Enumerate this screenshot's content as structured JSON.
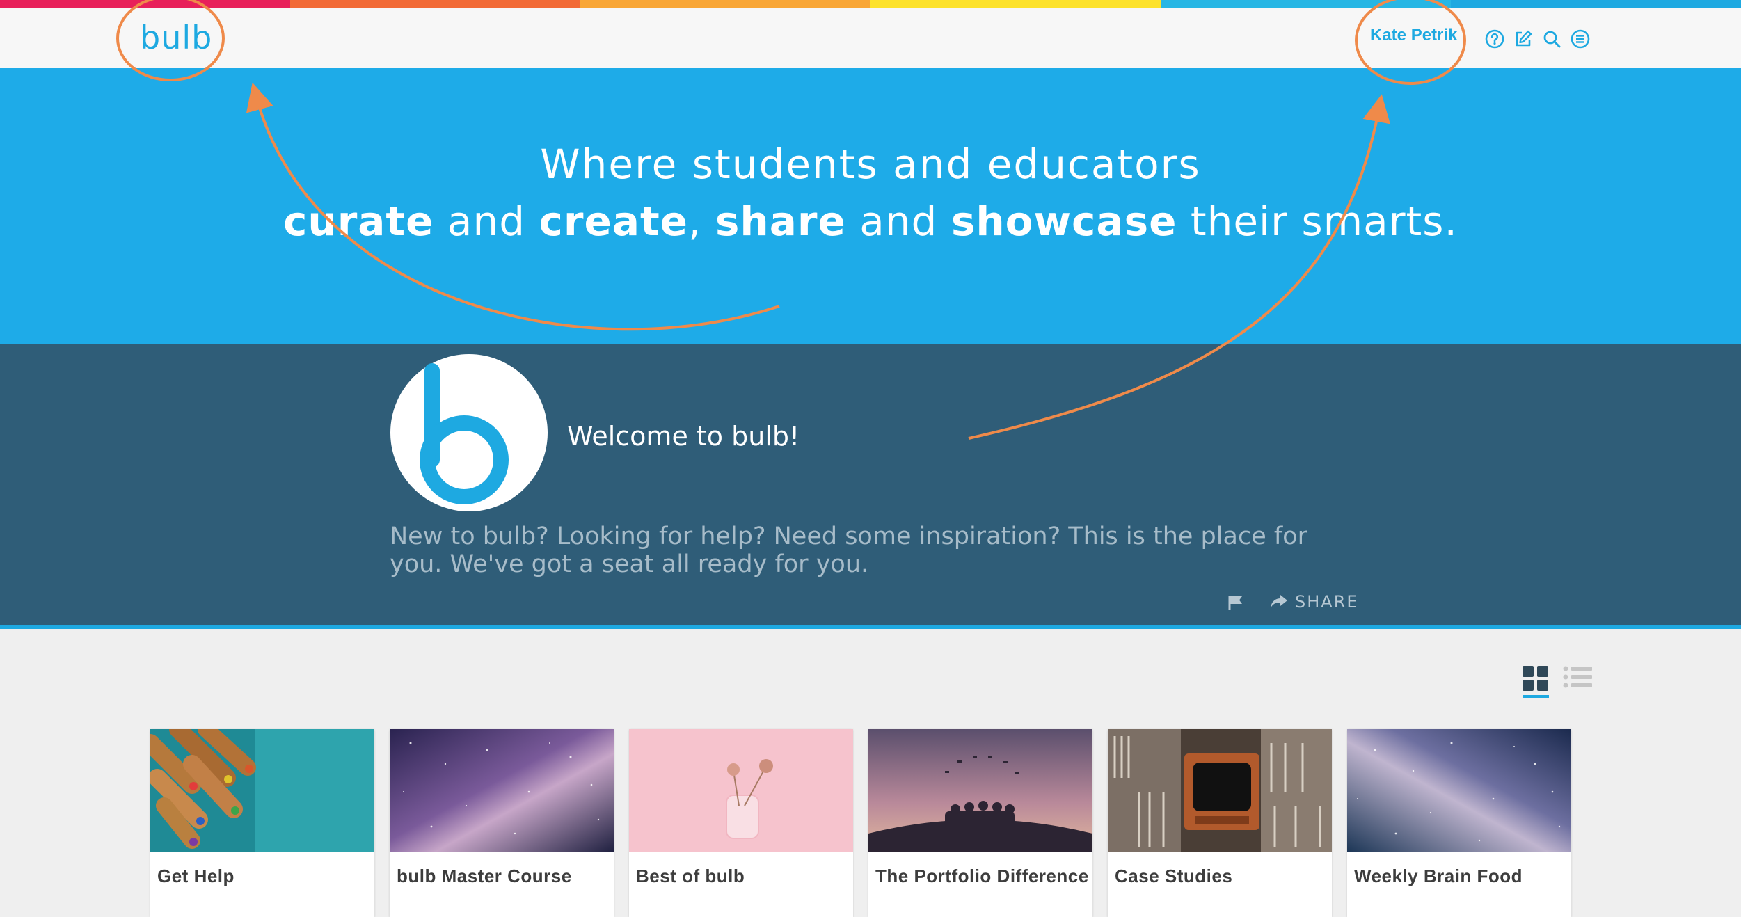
{
  "header": {
    "logo_text": "bulb",
    "user_name": "Kate Petrik",
    "icons": [
      "help-icon",
      "edit-icon",
      "search-icon",
      "menu-icon"
    ]
  },
  "hero": {
    "line1": "Where students and educators",
    "line2": {
      "w1": "curate",
      "t1": " and ",
      "w2": "create",
      "t2": ", ",
      "w3": "share",
      "t3": " and ",
      "w4": "showcase",
      "t4": " their smarts."
    }
  },
  "welcome": {
    "avatar_letter": "b",
    "title": "Welcome to bulb!",
    "description": "New to bulb? Looking for help? Need some inspiration? This is the place for you. We've got a seat all ready for you.",
    "share_label": "SHARE"
  },
  "cards": [
    {
      "title": "Get Help"
    },
    {
      "title": "bulb Master Course"
    },
    {
      "title": "Best of bulb"
    },
    {
      "title": "The Portfolio Difference"
    },
    {
      "title": "Case Studies"
    },
    {
      "title": "Weekly Brain Food"
    }
  ],
  "colors": {
    "brand_blue": "#1ea9e1",
    "hero_bg": "#1eabe8",
    "welcome_bg": "#2f5d78",
    "annotation": "#ef8a4a",
    "rainbow": [
      "#e8205a",
      "#f26a36",
      "#f9a636",
      "#fde22b",
      "#27b6e4",
      "#1ea9e1"
    ]
  }
}
